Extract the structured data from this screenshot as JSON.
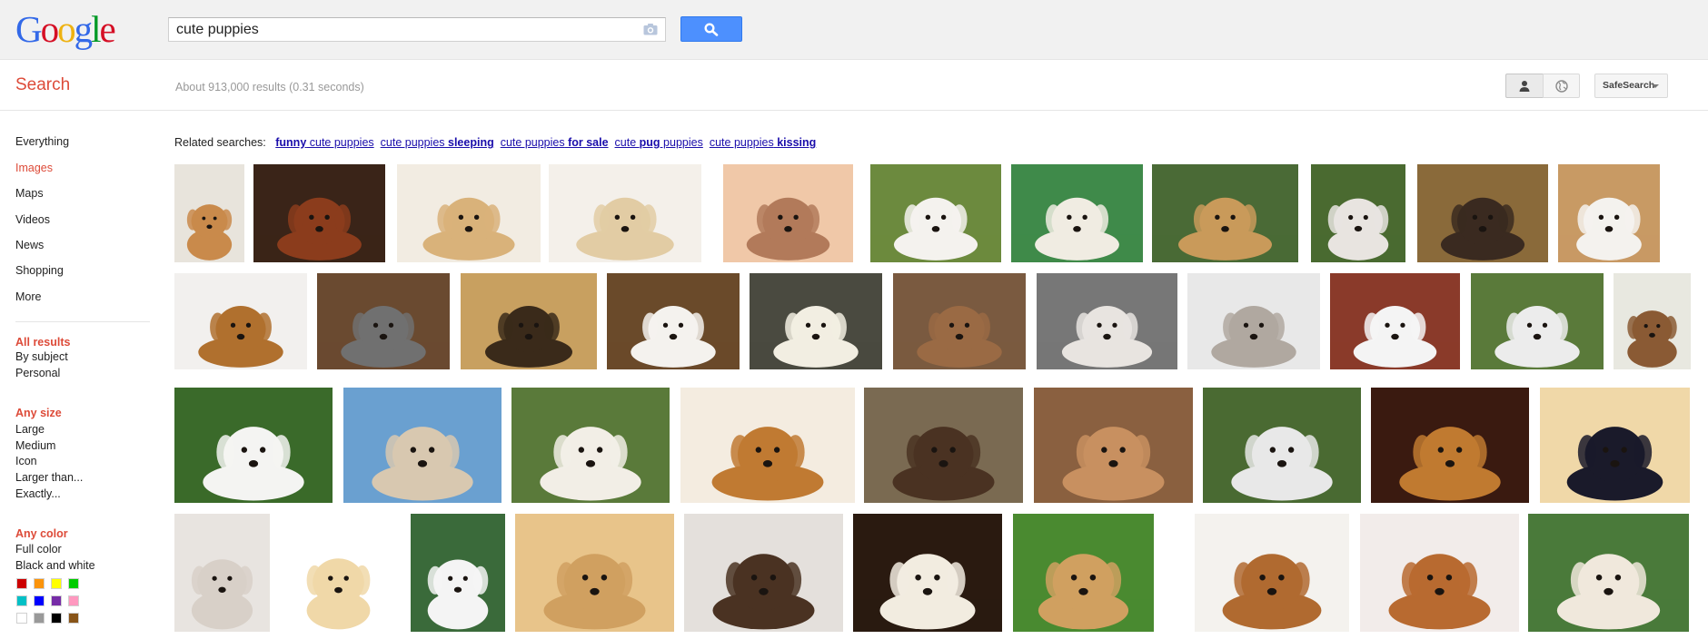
{
  "logo": {
    "letters": [
      {
        "ch": "G",
        "color": "#3369e8"
      },
      {
        "ch": "o",
        "color": "#d50f25"
      },
      {
        "ch": "o",
        "color": "#eeb211"
      },
      {
        "ch": "g",
        "color": "#3369e8"
      },
      {
        "ch": "l",
        "color": "#009925"
      },
      {
        "ch": "e",
        "color": "#d50f25"
      }
    ]
  },
  "search": {
    "query": "cute puppies",
    "button_icon": "magnifier-icon",
    "camera_icon": "camera-icon"
  },
  "subbar": {
    "title": "Search",
    "stats": "About 913,000 results (0.31 seconds)",
    "safesearch_label": "SafeSearch"
  },
  "nav": {
    "types": [
      "Everything",
      "Images",
      "Maps",
      "Videos",
      "News",
      "Shopping",
      "More"
    ],
    "selected_type": "Images",
    "results_group": {
      "heading": "All results",
      "items": [
        "By subject",
        "Personal"
      ]
    },
    "size_group": {
      "heading": "Any size",
      "items": [
        "Large",
        "Medium",
        "Icon",
        "Larger than...",
        "Exactly..."
      ]
    },
    "color_group": {
      "heading": "Any color",
      "items": [
        "Full color",
        "Black and white"
      ]
    },
    "swatches": [
      "#cc0000",
      "#fb940b",
      "#ffff00",
      "#00cc00",
      "#03c0c6",
      "#0000ff",
      "#762ca7",
      "#ff98bf",
      "#ffffff",
      "#999999",
      "#000000",
      "#885418"
    ]
  },
  "related": {
    "label": "Related searches:",
    "links": [
      {
        "bold": "funny",
        "rest": " cute puppies",
        "boldFirst": true
      },
      {
        "bold": " sleeping",
        "rest": "cute puppies",
        "boldFirst": false
      },
      {
        "bold": " for sale",
        "rest": "cute puppies",
        "boldFirst": false
      },
      {
        "pre": "cute ",
        "bold": "pug",
        "post": " puppies"
      },
      {
        "bold": " kissing",
        "rest": "cute puppies",
        "boldFirst": false
      }
    ]
  },
  "colors": {
    "accent": "#dd4b39",
    "link": "#1a0dab",
    "button": "#4d90fe"
  },
  "thumbnails": [
    {
      "row": 1,
      "dog": "#c98a4b",
      "bg": "#e8e4dc"
    },
    {
      "row": 1,
      "dog": "#8b3c1c",
      "bg": "#3a2418"
    },
    {
      "row": 1,
      "dog": "#d9b27a",
      "bg": "#f2ece2"
    },
    {
      "row": 1,
      "dog": "#e2cca4",
      "bg": "#f4f0ea"
    },
    {
      "row": 1,
      "dog": "#b27a5a",
      "bg": "#f0c8a8"
    },
    {
      "row": 1,
      "dog": "#f4f2ee",
      "bg": "#6c8a3e"
    },
    {
      "row": 1,
      "dog": "#f0ece2",
      "bg": "#3f8a4a"
    },
    {
      "row": 1,
      "dog": "#c99a5a",
      "bg": "#4a6a36"
    },
    {
      "row": 1,
      "dog": "#e8e4e0",
      "bg": "#4a6a30"
    },
    {
      "row": 1,
      "dog": "#3a2a20",
      "bg": "#8a6a3a"
    },
    {
      "row": 1,
      "dog": "#f4f2ee",
      "bg": "#c89a64"
    },
    {
      "row": 2,
      "dog": "#b0702e",
      "bg": "#f2f0ee"
    },
    {
      "row": 2,
      "dog": "#707070",
      "bg": "#6a4a30"
    },
    {
      "row": 2,
      "dog": "#3a2a1a",
      "bg": "#c8a060"
    },
    {
      "row": 2,
      "dog": "#f4f2ee",
      "bg": "#6a4a2a"
    },
    {
      "row": 2,
      "dog": "#f2eee2",
      "bg": "#4a4a40"
    },
    {
      "row": 2,
      "dog": "#9a6a44",
      "bg": "#7a5a40"
    },
    {
      "row": 2,
      "dog": "#e8e4e0",
      "bg": "#777777"
    },
    {
      "row": 2,
      "dog": "#b0a8a0",
      "bg": "#e8e8e8"
    },
    {
      "row": 2,
      "dog": "#f4f4f4",
      "bg": "#8a3a2a"
    },
    {
      "row": 2,
      "dog": "#ececec",
      "bg": "#5a7a3a"
    },
    {
      "row": 2,
      "dog": "#8a5a34",
      "bg": "#e8e8e0"
    },
    {
      "row": 3,
      "dog": "#f4f4f2",
      "bg": "#3a6a2a"
    },
    {
      "row": 3,
      "dog": "#d8c8b0",
      "bg": "#6aa0d0"
    },
    {
      "row": 3,
      "dog": "#f2eee6",
      "bg": "#5a7a3a"
    },
    {
      "row": 3,
      "dog": "#c07a32",
      "bg": "#f4ece0"
    },
    {
      "row": 3,
      "dog": "#4a3222",
      "bg": "#7a6a52"
    },
    {
      "row": 3,
      "dog": "#c89060",
      "bg": "#8a6040"
    },
    {
      "row": 3,
      "dog": "#e8e8e8",
      "bg": "#4a6a32"
    },
    {
      "row": 3,
      "dog": "#c07a30",
      "bg": "#3a1a10"
    },
    {
      "row": 3,
      "dog": "#1a1a2a",
      "bg": "#f0d8a8"
    },
    {
      "row": 4,
      "dog": "#d8d0c8",
      "bg": "#e8e4e0"
    },
    {
      "row": 4,
      "dog": "#f0d8a8",
      "bg": "#ffffff"
    },
    {
      "row": 4,
      "dog": "#f4f4f4",
      "bg": "#3a6a3a"
    },
    {
      "row": 4,
      "dog": "#d0a060",
      "bg": "#e8c48a"
    },
    {
      "row": 4,
      "dog": "#4a3222",
      "bg": "#e4e0dc"
    },
    {
      "row": 4,
      "dog": "#f2ece0",
      "bg": "#2a1a10"
    },
    {
      "row": 4,
      "dog": "#d0a060",
      "bg": "#4a8a30"
    },
    {
      "row": 4,
      "dog": "#b06a30",
      "bg": "#f4f2ee"
    },
    {
      "row": 4,
      "dog": "#b86a30",
      "bg": "#f2ecea"
    },
    {
      "row": 4,
      "dog": "#f0e8dc",
      "bg": "#4a7a3a"
    }
  ]
}
